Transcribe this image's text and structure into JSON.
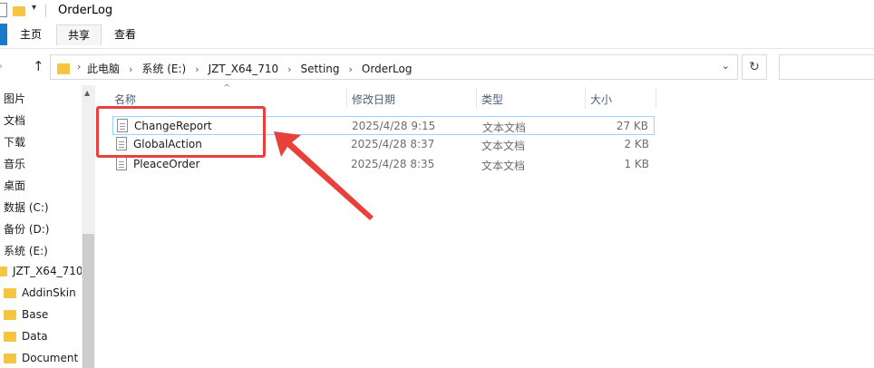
{
  "window": {
    "title": "OrderLog"
  },
  "ribbon": {
    "tabs": [
      {
        "label": "主页"
      },
      {
        "label": "共享"
      },
      {
        "label": "查看"
      }
    ]
  },
  "address": {
    "crumbs": [
      "此电脑",
      "系统 (E:)",
      "JZT_X64_710",
      "Setting",
      "OrderLog"
    ]
  },
  "nav": {
    "items": [
      {
        "label": "图片"
      },
      {
        "label": "文档"
      },
      {
        "label": "下载"
      },
      {
        "label": "音乐"
      },
      {
        "label": "桌面"
      },
      {
        "label": "数据 (C:)"
      },
      {
        "label": "备份 (D:)"
      },
      {
        "label": "系统 (E:)"
      },
      {
        "label": "JZT_X64_710"
      },
      {
        "label": "AddinSkin"
      },
      {
        "label": "Base"
      },
      {
        "label": "Data"
      },
      {
        "label": "Document"
      }
    ]
  },
  "columns": {
    "name": "名称",
    "date": "修改日期",
    "type": "类型",
    "size": "大小"
  },
  "files": [
    {
      "name": "ChangeReport",
      "date": "2025/4/28 9:15",
      "type": "文本文档",
      "size": "27 KB"
    },
    {
      "name": "GlobalAction",
      "date": "2025/4/28 8:37",
      "type": "文本文档",
      "size": "2 KB"
    },
    {
      "name": "PleaceOrder",
      "date": "2025/4/28 8:35",
      "type": "文本文档",
      "size": "1 KB"
    }
  ],
  "colors": {
    "accent": "#1979ca",
    "annotation": "#e8403a",
    "selection_border": "#99d1ff"
  },
  "icons": [
    "folder-icon",
    "down-arrow-icon",
    "back-arrow-icon",
    "up-arrow-icon",
    "refresh-icon",
    "text-file-icon"
  ]
}
